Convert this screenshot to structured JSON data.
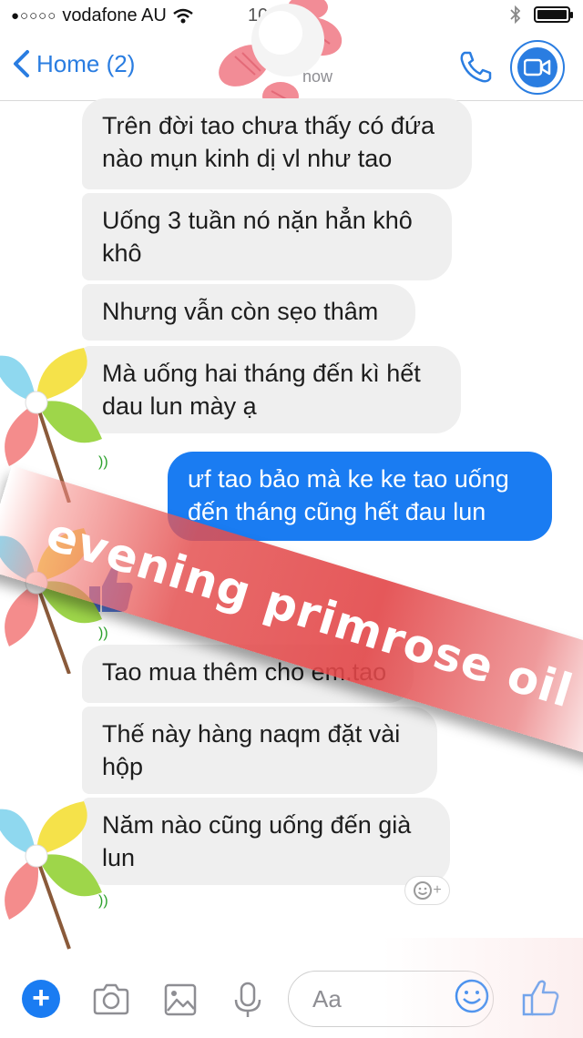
{
  "status_bar": {
    "signal": "●○○○○",
    "carrier": "vodafone AU",
    "time": "10"
  },
  "nav": {
    "back_label": "Home (2)",
    "subtitle": "now"
  },
  "messages": [
    {
      "from": "them",
      "text": "Trên đời tao chưa thấy có đứa nào mụn kinh dị vl như tao"
    },
    {
      "from": "them",
      "text": "Uống 3 tuần nó nặn hẳn khô khô"
    },
    {
      "from": "them",
      "text": "Nhưng vẫn còn sẹo thâm"
    },
    {
      "from": "them",
      "text": "Mà uống hai tháng đến kì hết dau lun mày ạ"
    },
    {
      "from": "me",
      "text": "ưf tao bảo mà ke ke tao uống đến tháng cũng hết đau lun"
    },
    {
      "from": "them",
      "text": "Tao mua thêm cho em.tao"
    },
    {
      "from": "them",
      "text": "Thế này hàng naqm đặt vài hộp"
    },
    {
      "from": "them",
      "text": "Năm nào cũng uống đến già lun"
    }
  ],
  "banner": {
    "text": "evening primrose oil"
  },
  "composer": {
    "placeholder": "Aa"
  },
  "colors": {
    "accent": "#1a7cf2",
    "incoming_bubble": "#efefef",
    "banner": "#e24648"
  },
  "icons": [
    "plus-icon",
    "camera-icon",
    "image-icon",
    "microphone-icon",
    "smile-icon",
    "thumbs-up-icon",
    "phone-icon",
    "video-icon",
    "chevron-left-icon",
    "wifi-icon",
    "bluetooth-icon",
    "battery-icon"
  ]
}
